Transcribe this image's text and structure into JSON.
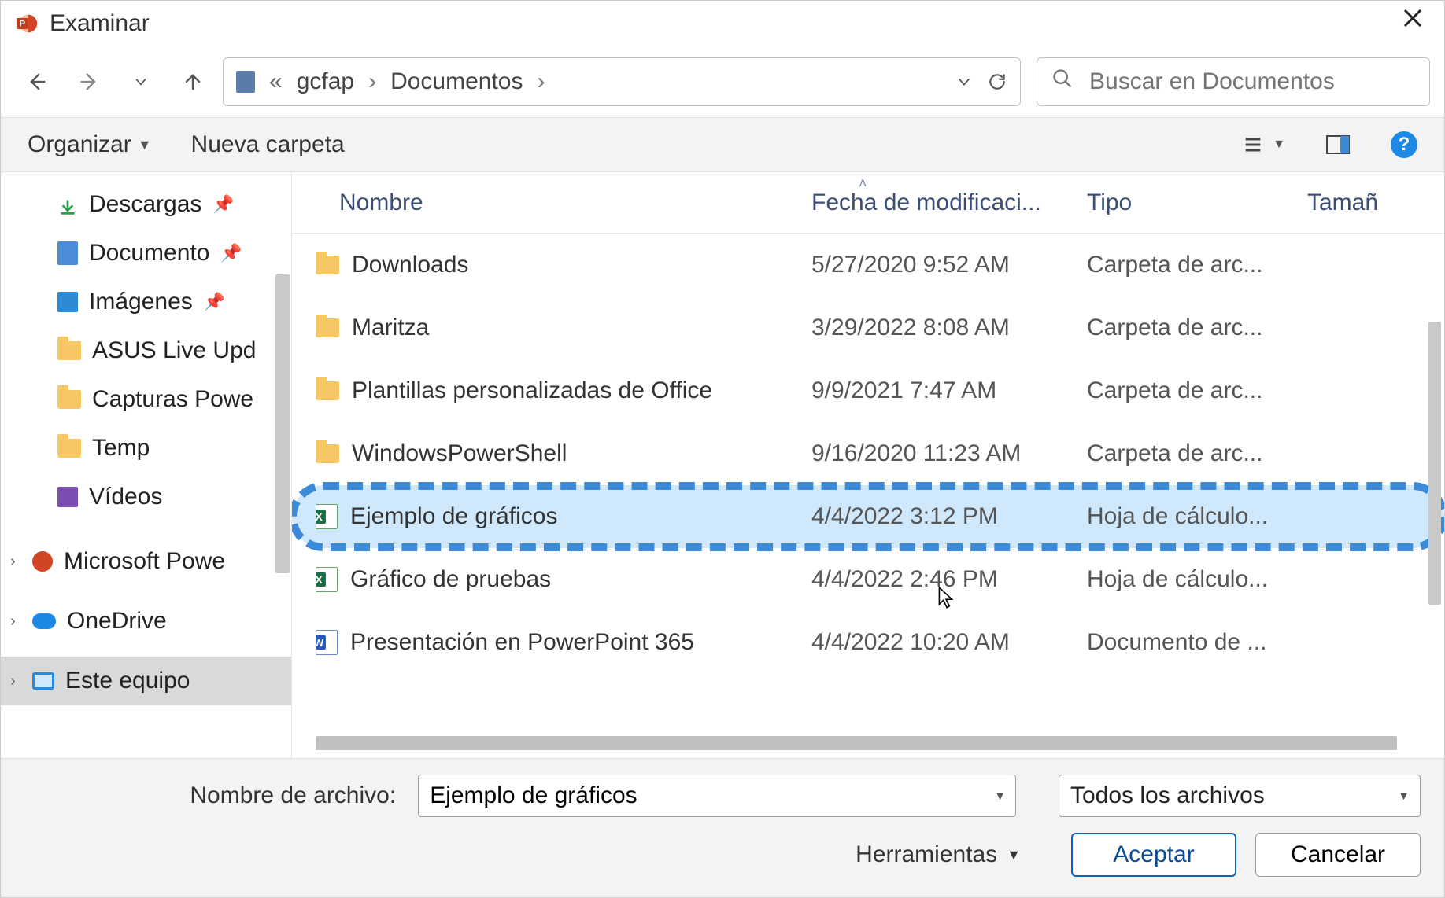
{
  "title": "Examinar",
  "breadcrumb": {
    "seg1": "gcfap",
    "seg2": "Documentos"
  },
  "search": {
    "placeholder": "Buscar en Documentos"
  },
  "toolbar": {
    "organize": "Organizar",
    "newfolder": "Nueva carpeta"
  },
  "columns": {
    "name": "Nombre",
    "date": "Fecha de modificaci...",
    "type": "Tipo",
    "size": "Tamañ"
  },
  "sidebar": {
    "items": [
      {
        "label": "Descargas",
        "icon": "download",
        "pinned": true
      },
      {
        "label": "Documentos",
        "icon": "docblue",
        "pinned": true,
        "truncated": "Documento"
      },
      {
        "label": "Imágenes",
        "icon": "pictures",
        "pinned": true
      },
      {
        "label": "ASUS Live Upd",
        "icon": "folder",
        "truncated": "ASUS Live Upd"
      },
      {
        "label": "Capturas Powe",
        "icon": "folder",
        "truncated": "Capturas Powe"
      },
      {
        "label": "Temp",
        "icon": "folder"
      },
      {
        "label": "Vídeos",
        "icon": "purple"
      },
      {
        "label": "Microsoft Powe",
        "icon": "ppt",
        "chev": true,
        "truncated": "Microsoft Powe"
      },
      {
        "label": "OneDrive",
        "icon": "cloud",
        "chev": true
      },
      {
        "label": "Este equipo",
        "icon": "monitor",
        "chev": true,
        "selected": true
      }
    ]
  },
  "files": [
    {
      "name": "Downloads",
      "date": "5/27/2020 9:52 AM",
      "type": "Carpeta de arc...",
      "icon": "folder"
    },
    {
      "name": "Maritza",
      "date": "3/29/2022 8:08 AM",
      "type": "Carpeta de arc...",
      "icon": "folder"
    },
    {
      "name": "Plantillas personalizadas de Office",
      "date": "9/9/2021 7:47 AM",
      "type": "Carpeta de arc...",
      "icon": "folder"
    },
    {
      "name": "WindowsPowerShell",
      "date": "9/16/2020 11:23 AM",
      "type": "Carpeta de arc...",
      "icon": "folder"
    },
    {
      "name": "Ejemplo de gráficos",
      "date": "4/4/2022 3:12 PM",
      "type": "Hoja de cálculo...",
      "icon": "excel",
      "selected": true,
      "highlight": true
    },
    {
      "name": "Gráfico de pruebas",
      "date": "4/4/2022 2:46 PM",
      "type": "Hoja de cálculo...",
      "icon": "excel"
    },
    {
      "name": "Presentación en PowerPoint 365",
      "date": "4/4/2022 10:20 AM",
      "type": "Documento de ...",
      "icon": "word"
    }
  ],
  "bottom": {
    "filename_label": "Nombre de archivo:",
    "filename_value": "Ejemplo de gráficos",
    "filter_value": "Todos los archivos",
    "tools": "Herramientas",
    "accept": "Aceptar",
    "cancel": "Cancelar"
  }
}
